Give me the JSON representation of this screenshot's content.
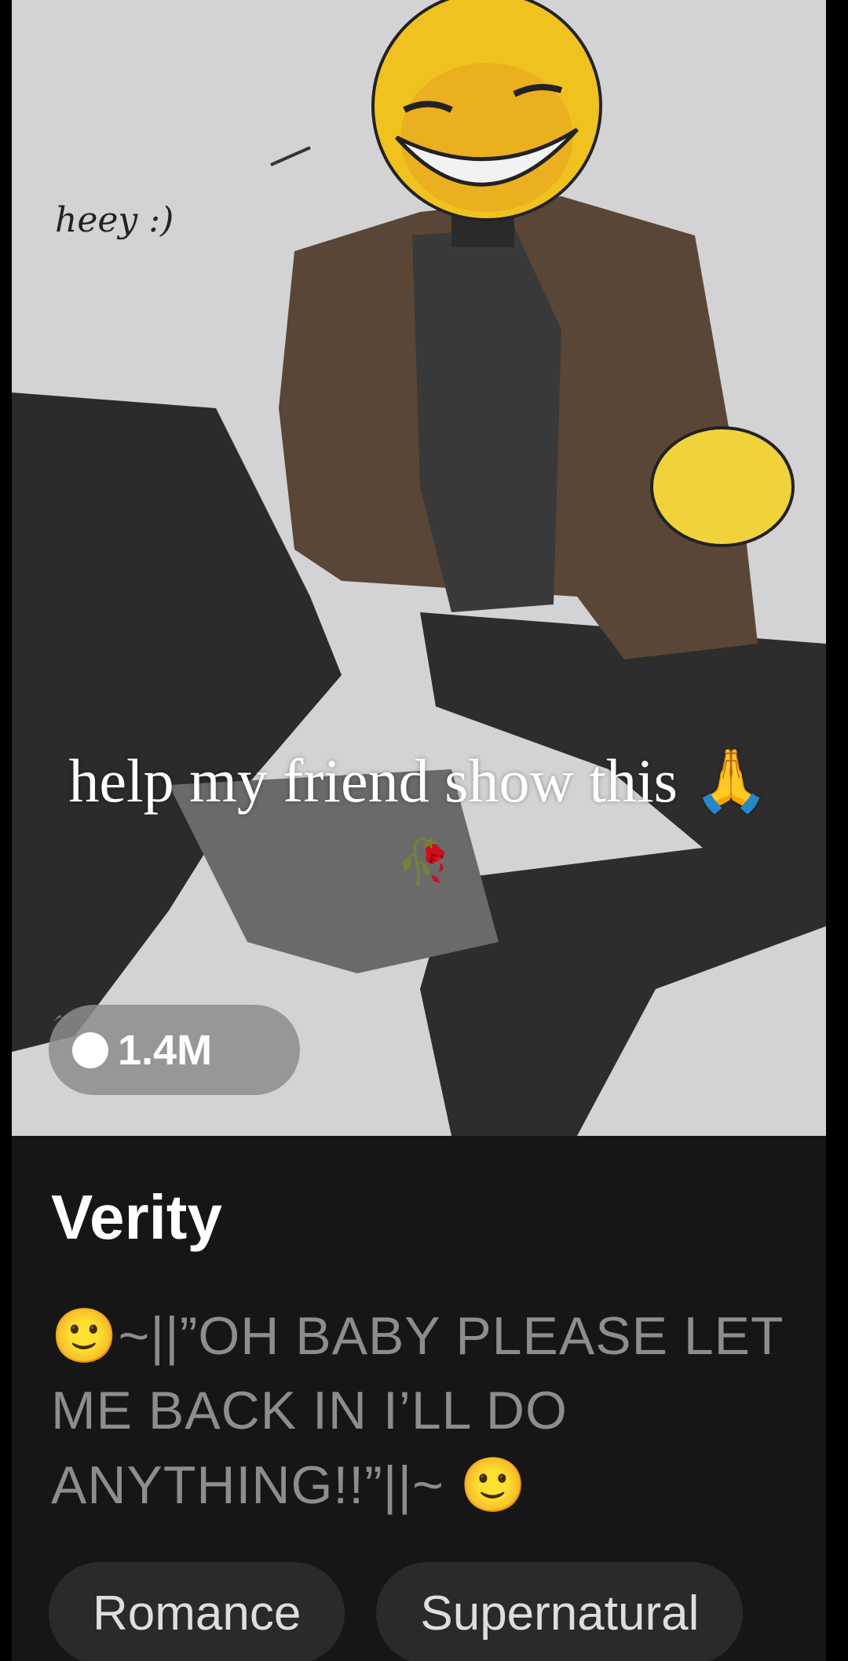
{
  "art": {
    "handwritten_caption": "heey :)"
  },
  "overlay": {
    "caption": "help my friend show this 🙏",
    "rose_emoji": "🥀"
  },
  "stats": {
    "views": "1.4M",
    "icon": "messenger-icon"
  },
  "story": {
    "title": "Verity",
    "description": "🙂~||”OH BABY PLEASE LET ME BACK IN I’LL DO ANYTHING!!”||~ 🙂"
  },
  "tags": [
    "Romance",
    "Supernatural"
  ],
  "colors": {
    "card_bg": "#161616",
    "tag_bg": "#2a2a2a",
    "description_text": "#8d8d8d",
    "artwork_bg": "#d3d3d5"
  }
}
